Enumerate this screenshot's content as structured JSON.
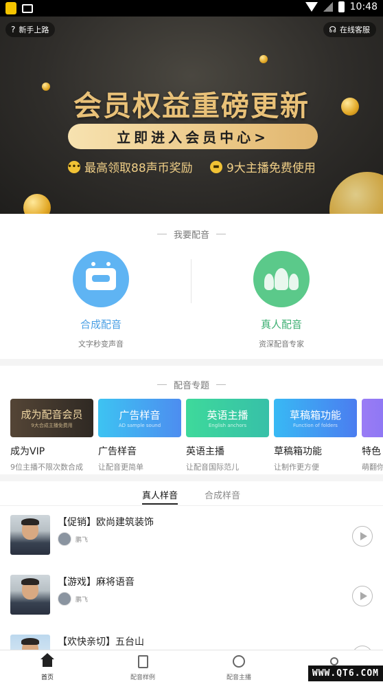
{
  "status_bar": {
    "time": "10:48"
  },
  "banner": {
    "help_label": "新手上路",
    "service_label": "在线客服",
    "title": "会员权益重磅更新",
    "cta_label": "立即进入会员中心>",
    "perks": [
      "最高领取88声币奖励",
      "9大主播免费使用"
    ]
  },
  "dubbing": {
    "section_title": "我要配音",
    "options": [
      {
        "name": "合成配音",
        "desc": "文字秒变声音"
      },
      {
        "name": "真人配音",
        "desc": "资深配音专家"
      }
    ]
  },
  "topics": {
    "section_title": "配音专题",
    "items": [
      {
        "thumb_title": "成为配音会员",
        "thumb_sub": "9大合成主播免费用",
        "title": "成为VIP",
        "sub": "9位主播不限次数合成",
        "color": "#3b3229"
      },
      {
        "thumb_title": "广告样音",
        "thumb_sub": "AD sample sound",
        "title": "广告样音",
        "sub": "让配音更简单",
        "color": "#4aa8f0"
      },
      {
        "thumb_title": "英语主播",
        "thumb_sub": "English anchors",
        "title": "英语主播",
        "sub": "让配音国际范儿",
        "color": "#3fcf9a"
      },
      {
        "thumb_title": "草稿箱功能",
        "thumb_sub": "Function of folders",
        "title": "草稿箱功能",
        "sub": "让制作更方便",
        "color": "#4a8ff0"
      },
      {
        "thumb_title": "",
        "thumb_sub": "",
        "title": "特色",
        "sub": "萌翻你",
        "color": "#7e6ff5"
      }
    ]
  },
  "samples": {
    "tabs": [
      "真人样音",
      "合成样音"
    ],
    "items": [
      {
        "title": "【促销】欧尚建筑装饰",
        "author": "鹏飞"
      },
      {
        "title": "【游戏】麻将语音",
        "author": "鹏飞"
      },
      {
        "title": "【欢快亲切】五台山",
        "author": ""
      }
    ]
  },
  "bottom_nav": {
    "items": [
      {
        "label": "首页",
        "icon": "home-icon"
      },
      {
        "label": "配音样例",
        "icon": "sample-icon"
      },
      {
        "label": "配音主播",
        "icon": "anchor-icon"
      },
      {
        "label": "",
        "icon": "profile-icon"
      }
    ]
  },
  "watermark": "WWW.QT6.COM"
}
